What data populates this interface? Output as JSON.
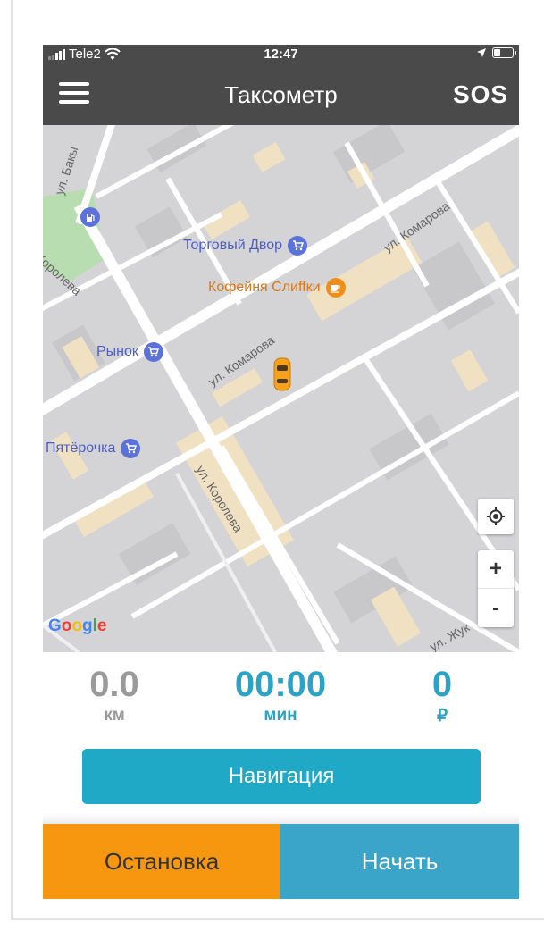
{
  "status_bar": {
    "carrier": "Tele2",
    "time": "12:47",
    "battery_level": 0.3
  },
  "header": {
    "title": "Таксометр",
    "sos_label": "SOS"
  },
  "map": {
    "pois": {
      "torgovy": "Торговый Двор",
      "coffee": "Кофейня Слиffки",
      "rynok": "Рынок",
      "pyaterochka": "Пятёрочка"
    },
    "streets": {
      "baky": "ул. Бакы",
      "koroleva_top": "Королева",
      "komarova_mid": "ул. Комарова",
      "komarova_right": "ул. Комарова",
      "koroleva_bottom": "ул. Королева",
      "zhuk": "ул. Жук"
    },
    "attribution": [
      "G",
      "o",
      "o",
      "g",
      "l",
      "e"
    ],
    "zoom_in": "+",
    "zoom_out": "-",
    "colors": {
      "blue_poi": "#5b72da",
      "orange_poi": "#ef8f1a"
    }
  },
  "stats": {
    "distance": {
      "value": "0.0",
      "unit": "км"
    },
    "time": {
      "value": "00:00",
      "unit": "мин"
    },
    "price": {
      "value": "0",
      "unit": "₽"
    }
  },
  "buttons": {
    "navigation": "Навигация",
    "stop": "Остановка",
    "start": "Начать"
  },
  "colors": {
    "accent_teal": "#20a8c7",
    "stop_orange": "#f7960f",
    "header_dark": "#4a4a4a"
  }
}
